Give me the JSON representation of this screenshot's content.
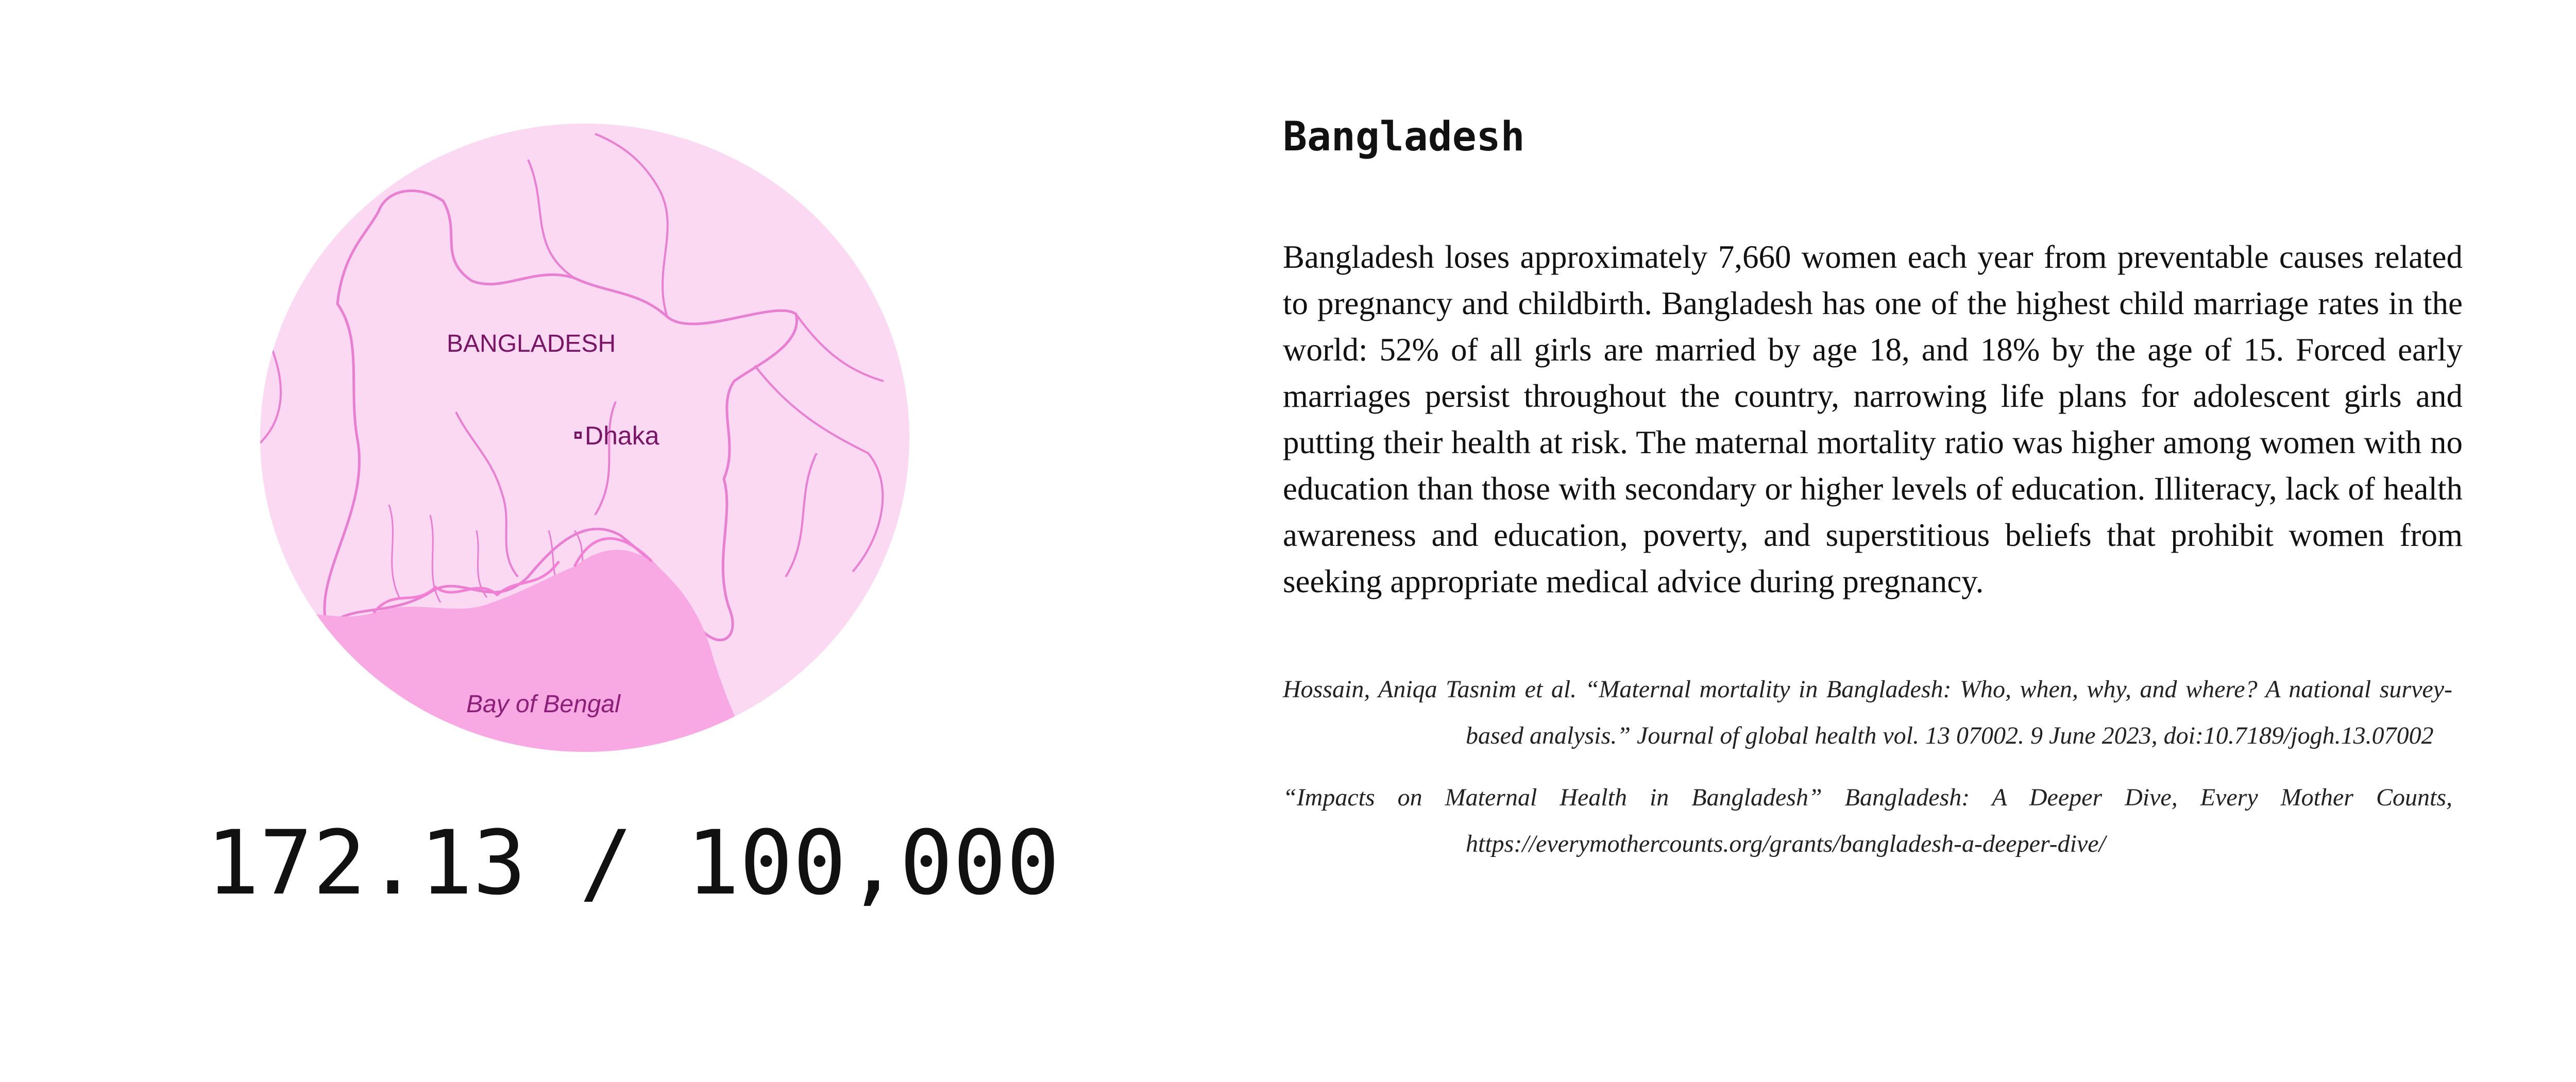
{
  "map": {
    "country_label": "BANGLADESH",
    "city_label": "Dhaka",
    "sea_label": "Bay of Bengal",
    "icon": "map-illustration",
    "colors": {
      "land": "#fcd9f3",
      "sea": "#f8a8e2",
      "border": "#e87fd0",
      "label": "#7a1565"
    }
  },
  "stat": {
    "ratio": "172.13 / 100,000"
  },
  "content": {
    "title": "Bangladesh",
    "description": "Bangladesh loses approximately 7,660 women each year from preventable causes related to pregnancy and childbirth. Bangladesh has one of the highest child marriage rates in the world: 52% of all girls are married by age 18, and 18% by the age of 15. Forced early marriages persist throughout the country, narrowing life plans for adolescent girls and putting their health at risk. The maternal mortality ratio was higher among women with no education than those with secondary or higher levels of education. Illiteracy, lack of health awareness and education, poverty, and superstitious beliefs that prohibit women from seeking appropriate medical advice during pregnancy."
  },
  "citations": [
    "Hossain, Aniqa Tasnim et al. “Maternal mortality in Bangladesh: Who, when, why, and where? A national survey-based analysis.” Journal of global health vol. 13 07002. 9 June 2023, doi:10.7189/jogh.13.07002",
    "“Impacts on Maternal Health in Bangladesh” Bangladesh: A Deeper Dive, Every Mother Counts, https://everymothercounts.org/grants/bangladesh-a-deeper-dive/"
  ]
}
